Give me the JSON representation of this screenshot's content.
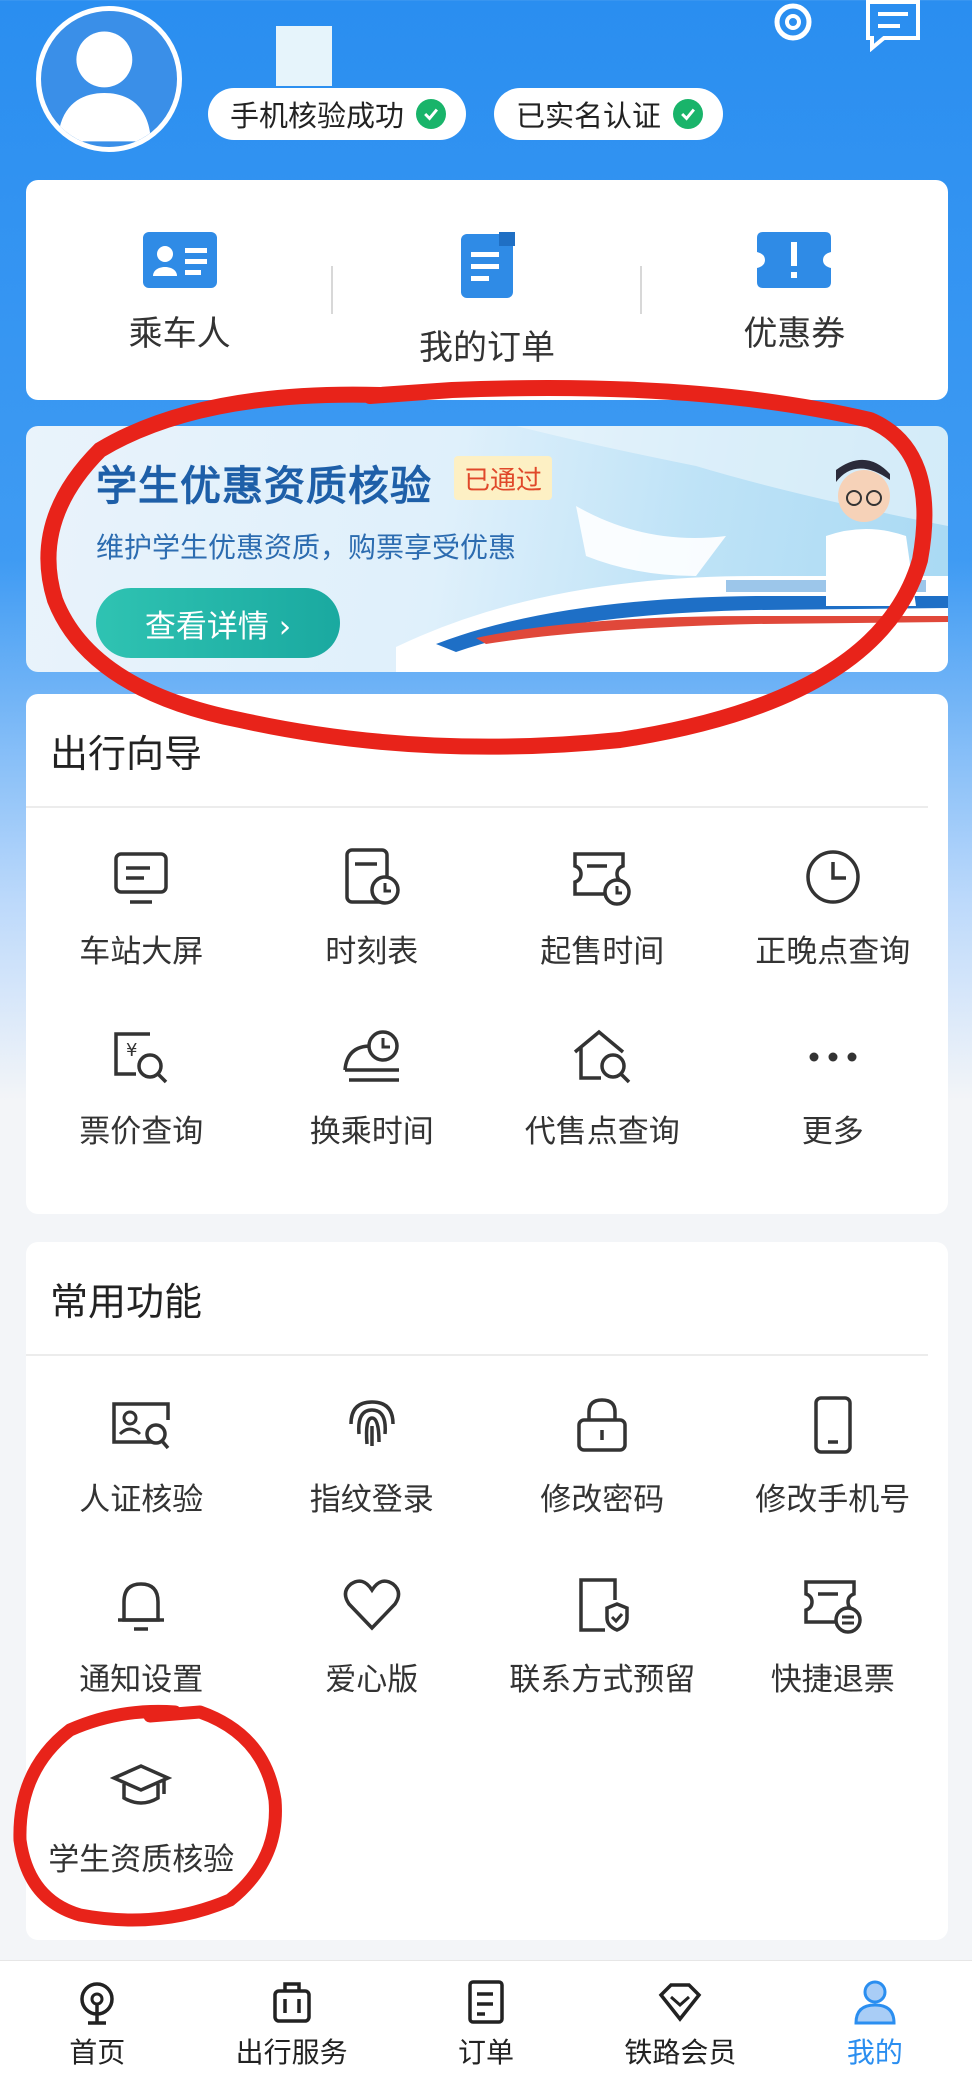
{
  "header": {
    "badges": [
      {
        "label": "手机核验成功"
      },
      {
        "label": "已实名认证"
      }
    ]
  },
  "quick_actions": [
    {
      "label": "乘车人",
      "icon": "id-card-icon"
    },
    {
      "label": "我的订单",
      "icon": "order-doc-icon"
    },
    {
      "label": "优惠券",
      "icon": "coupon-icon"
    }
  ],
  "banner": {
    "title": "学生优惠资质核验",
    "status": "已通过",
    "subtitle": "维护学生优惠资质，购票享受优惠",
    "button": "查看详情 ›"
  },
  "travel_guide": {
    "title": "出行向导",
    "items": [
      {
        "label": "车站大屏",
        "icon": "station-screen-icon"
      },
      {
        "label": "时刻表",
        "icon": "timetable-icon"
      },
      {
        "label": "起售时间",
        "icon": "sale-time-icon"
      },
      {
        "label": "正晚点查询",
        "icon": "clock-icon"
      },
      {
        "label": "票价查询",
        "icon": "price-search-icon"
      },
      {
        "label": "换乘时间",
        "icon": "transfer-time-icon"
      },
      {
        "label": "代售点查询",
        "icon": "agency-search-icon"
      },
      {
        "label": "更多",
        "icon": "more-icon"
      }
    ]
  },
  "common_functions": {
    "title": "常用功能",
    "items": [
      {
        "label": "人证核验",
        "icon": "id-verify-icon"
      },
      {
        "label": "指纹登录",
        "icon": "fingerprint-icon"
      },
      {
        "label": "修改密码",
        "icon": "lock-icon"
      },
      {
        "label": "修改手机号",
        "icon": "phone-icon"
      },
      {
        "label": "通知设置",
        "icon": "bell-icon"
      },
      {
        "label": "爱心版",
        "icon": "heart-icon"
      },
      {
        "label": "联系方式预留",
        "icon": "contact-shield-icon"
      },
      {
        "label": "快捷退票",
        "icon": "refund-ticket-icon"
      },
      {
        "label": "学生资质核验",
        "icon": "graduation-cap-icon"
      }
    ]
  },
  "tabbar": [
    {
      "label": "首页",
      "icon": "home-icon"
    },
    {
      "label": "出行服务",
      "icon": "luggage-icon"
    },
    {
      "label": "订单",
      "icon": "order-icon"
    },
    {
      "label": "铁路会员",
      "icon": "member-gem-icon"
    },
    {
      "label": "我的",
      "icon": "person-icon",
      "active": true
    }
  ],
  "colors": {
    "brand": "#2a8ef0",
    "annotation": "#e8231a",
    "verified": "#19b46a"
  }
}
